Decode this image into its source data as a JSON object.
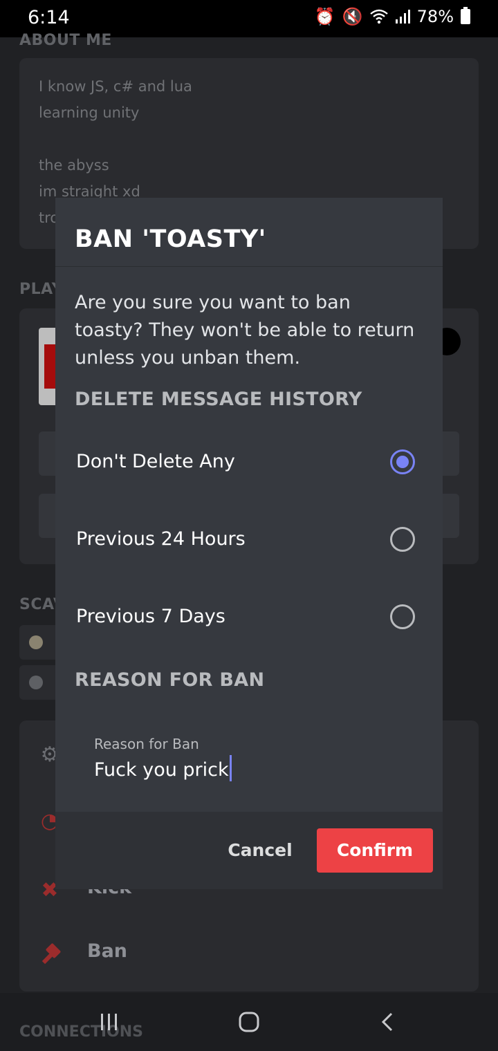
{
  "status_bar": {
    "time": "6:14",
    "battery": "78%"
  },
  "background": {
    "about_title": "ABOUT ME",
    "about_text": "I know JS, c# and lua\nlearning unity\n\nthe abyss\nim straight xd\ntro",
    "playing_title": "PLAY",
    "scavenger_title": "SCAV",
    "actions": [
      {
        "label": "Kick",
        "icon": "kick-user-icon"
      },
      {
        "label": "Ban",
        "icon": "hammer-icon"
      }
    ]
  },
  "modal": {
    "title": "BAN 'TOASTY'",
    "description": "Are you sure you want to ban toasty? They won't be able to return unless you unban them.",
    "history_label": "DELETE MESSAGE HISTORY",
    "options": [
      {
        "label": "Don't Delete Any",
        "selected": true
      },
      {
        "label": "Previous 24 Hours",
        "selected": false
      },
      {
        "label": "Previous 7 Days",
        "selected": false
      }
    ],
    "reason_label": "REASON FOR BAN",
    "reason_caption": "Reason for Ban",
    "reason_value": "Fuck you prick",
    "cancel_label": "Cancel",
    "confirm_label": "Confirm"
  },
  "navbar": {
    "connections_label": "CONNECTIONS"
  },
  "colors": {
    "accent": "#7983f5",
    "danger": "#ed4245",
    "modal_bg": "#36393f"
  }
}
